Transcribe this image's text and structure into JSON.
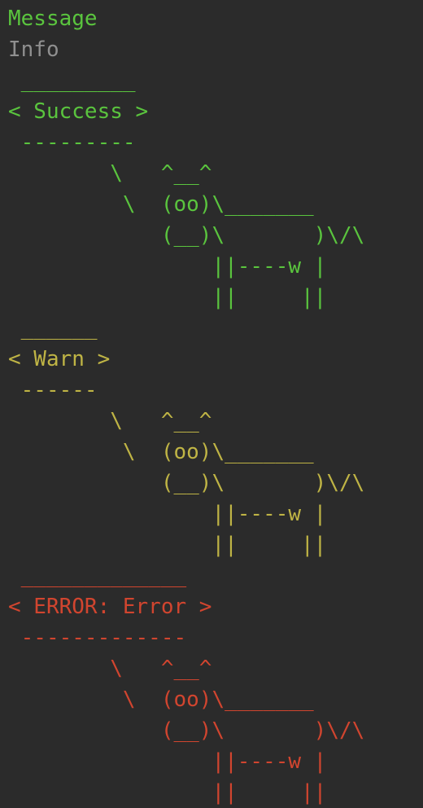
{
  "terminal": {
    "header": {
      "line1": "Message",
      "line2": "Info"
    },
    "blocks": [
      {
        "level": "success",
        "color": "#5ac43e",
        "lines": [
          " _________",
          "< Success >",
          " ---------",
          "        \\   ^__^",
          "         \\  (oo)\\_______",
          "            (__)\\       )\\/\\",
          "                ||----w |",
          "                ||     ||"
        ]
      },
      {
        "level": "warn",
        "color": "#bfb445",
        "lines": [
          " ______",
          "< Warn >",
          " ------",
          "        \\   ^__^",
          "         \\  (oo)\\_______",
          "            (__)\\       )\\/\\",
          "                ||----w |",
          "                ||     ||"
        ]
      },
      {
        "level": "error",
        "color": "#d1452f",
        "lines": [
          " _____________",
          "< ERROR: Error >",
          " -------------",
          "        \\   ^__^",
          "         \\  (oo)\\_______",
          "            (__)\\       )\\/\\",
          "                ||----w |",
          "                ||     ||"
        ]
      }
    ]
  }
}
